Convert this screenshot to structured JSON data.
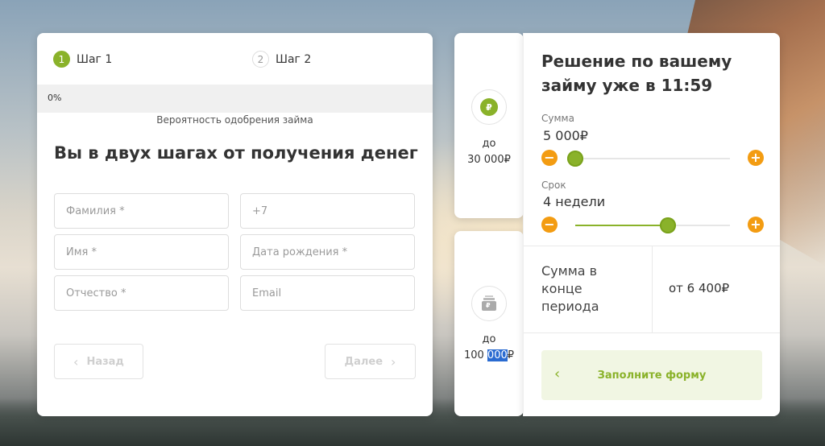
{
  "steps": [
    {
      "num": "1",
      "label": "Шаг 1"
    },
    {
      "num": "2",
      "label": "Шаг 2"
    }
  ],
  "progress": {
    "percent": 0,
    "label": "0%"
  },
  "approval_label": "Вероятность одобрения займа",
  "form_title": "Вы в двух шагах от получения денег",
  "fields": {
    "last_name": "Фамилия *",
    "phone": "+7",
    "first_name": "Имя *",
    "birth_date": "Дата рождения *",
    "patronymic": "Отчество *",
    "email": "Email"
  },
  "nav": {
    "back": "Назад",
    "next": "Далее",
    "back_icon": "chevron-left-icon",
    "next_icon": "chevron-right-icon"
  },
  "amount_cards": [
    {
      "icon": "ruble-coin-icon",
      "glyph": "₽",
      "line1": "до",
      "line2": "30 000₽"
    },
    {
      "icon": "money-stack-icon",
      "glyph": "₽",
      "line1": "до",
      "line2_a": "100 ",
      "line2_b": "000",
      "line2_c": "₽"
    }
  ],
  "calc": {
    "title": "Решение по вашему займу уже в 11:59",
    "sum_label": "Сумма",
    "sum_value": "5 000₽",
    "sum_level": 0.0,
    "term_label": "Срок",
    "term_value": "4 недели",
    "term_level": 0.6,
    "minus": "−",
    "plus": "+",
    "end_label": "Сумма в конце периода",
    "end_value": "от 6 400₽",
    "cta_label": "Заполните форму",
    "cta_icon": "chevron-left-icon"
  },
  "colors": {
    "accent": "#8ab22a",
    "slider_button": "#f39c12",
    "cta_bg": "#f1f6e3"
  }
}
